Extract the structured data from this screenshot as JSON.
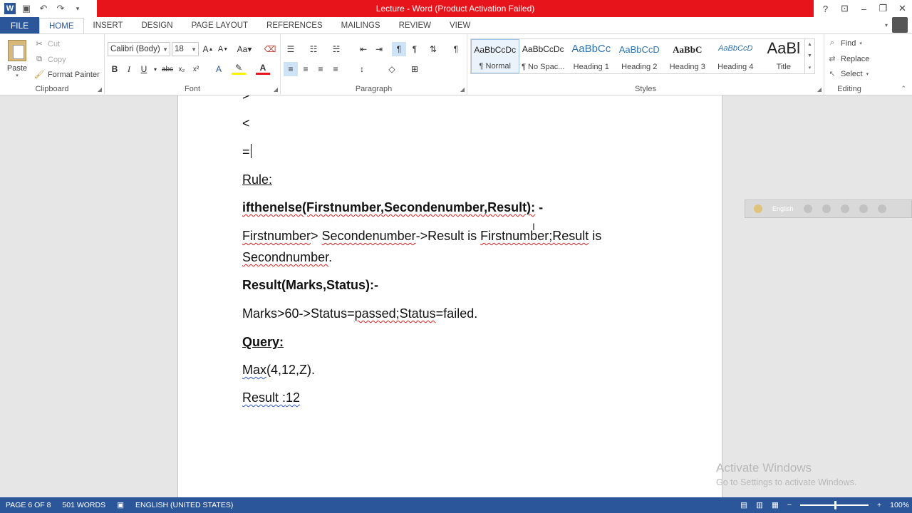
{
  "window": {
    "title": "Lecture -  Word (Product Activation Failed)"
  },
  "colors": {
    "brand": "#2b579a",
    "title_alert": "#e8141c",
    "spelling": "#e02020",
    "grammar": "#2f5cd6"
  },
  "tabs": {
    "file": "FILE",
    "items": [
      "HOME",
      "INSERT",
      "DESIGN",
      "PAGE LAYOUT",
      "REFERENCES",
      "MAILINGS",
      "REVIEW",
      "VIEW"
    ]
  },
  "clipboard": {
    "paste": "Paste",
    "cut": "Cut",
    "copy": "Copy",
    "format_painter": "Format Painter",
    "label": "Clipboard"
  },
  "font": {
    "name": "Calibri (Body)",
    "size": "18",
    "label": "Font"
  },
  "paragraph": {
    "label": "Paragraph"
  },
  "styles": {
    "label": "Styles",
    "items": [
      {
        "sample": "AaBbCcDc",
        "name": "¶ Normal"
      },
      {
        "sample": "AaBbCcDc",
        "name": "¶ No Spac..."
      },
      {
        "sample": "AaBbCc",
        "name": "Heading 1"
      },
      {
        "sample": "AaBbCcD",
        "name": "Heading 2"
      },
      {
        "sample": "AaBbC",
        "name": "Heading 3"
      },
      {
        "sample": "AaBbCcD",
        "name": "Heading 4"
      },
      {
        "sample": "AaBl",
        "name": "Title"
      }
    ]
  },
  "editing": {
    "find": "Find",
    "replace": "Replace",
    "select": "Select",
    "label": "Editing"
  },
  "document": {
    "line_gt": ">",
    "line_lt": "<",
    "line_eq": "=",
    "rule_heading": "Rule:",
    "rule_sig": "ifthenelse(Firstnumber,Secondenumber,Result):",
    "rule_sig_tail": " -",
    "rule_body_1a": "Firstnumber",
    "rule_body_1b": "> ",
    "rule_body_1c": "Secondenumber",
    "rule_body_1d": "->Result is ",
    "rule_body_1e": "Firstnumber;Result",
    "rule_body_1f": " is",
    "rule_body_2": "Secondnumber",
    "rule_body_2_tail": ".",
    "result_sig": "Result(Marks,Status):-",
    "result_body_a": " Marks>60->Status=",
    "result_body_b": "passed;Status",
    "result_body_c": "=failed.",
    "query_heading": "Query:",
    "query_a": "Max",
    "query_b": "(4,12,Z).",
    "result_a": "Result :",
    "result_b": "12"
  },
  "language_bar": {
    "language": "English"
  },
  "watermark": {
    "title": "Activate Windows",
    "subtitle": "Go to Settings to activate Windows."
  },
  "status": {
    "page": "PAGE 6 OF 8",
    "words": "501 WORDS",
    "language": "ENGLISH (UNITED STATES)",
    "zoom": "100%"
  }
}
